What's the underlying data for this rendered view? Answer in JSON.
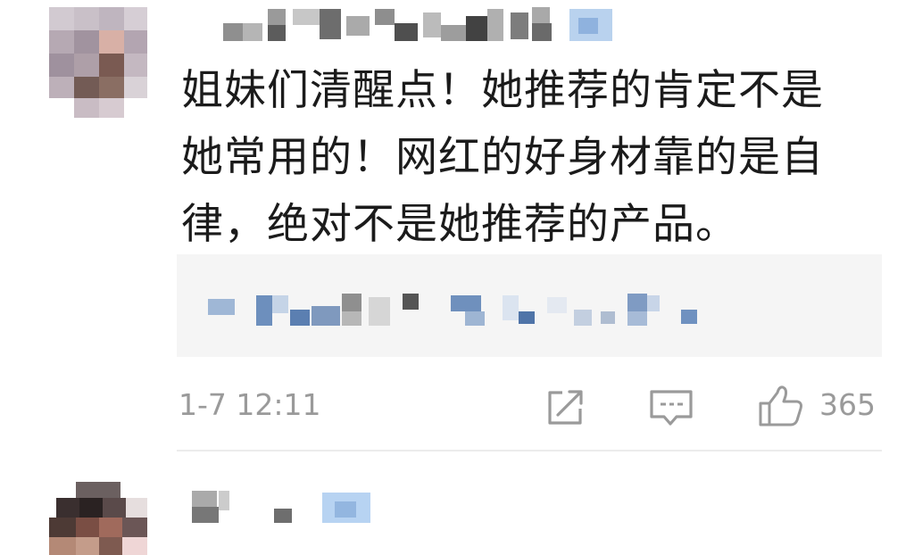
{
  "comment": {
    "text": "姐妹们清醒点！她推荐的肯定不是\n她常用的！网红的好身材靠的是自\n律，绝对不是她推荐的产品。",
    "timestamp": "1-7 12:11",
    "like_count": "365",
    "share_icon": "share-icon",
    "comment_icon": "comment-icon",
    "like_icon": "thumbs-up-icon"
  },
  "colors": {
    "text": "#1b1b1b",
    "meta_gray": "#9a9a9a",
    "reply_background": "#f5f5f5",
    "divider": "#ececec",
    "mosaic_blue": "#5b87c1"
  }
}
